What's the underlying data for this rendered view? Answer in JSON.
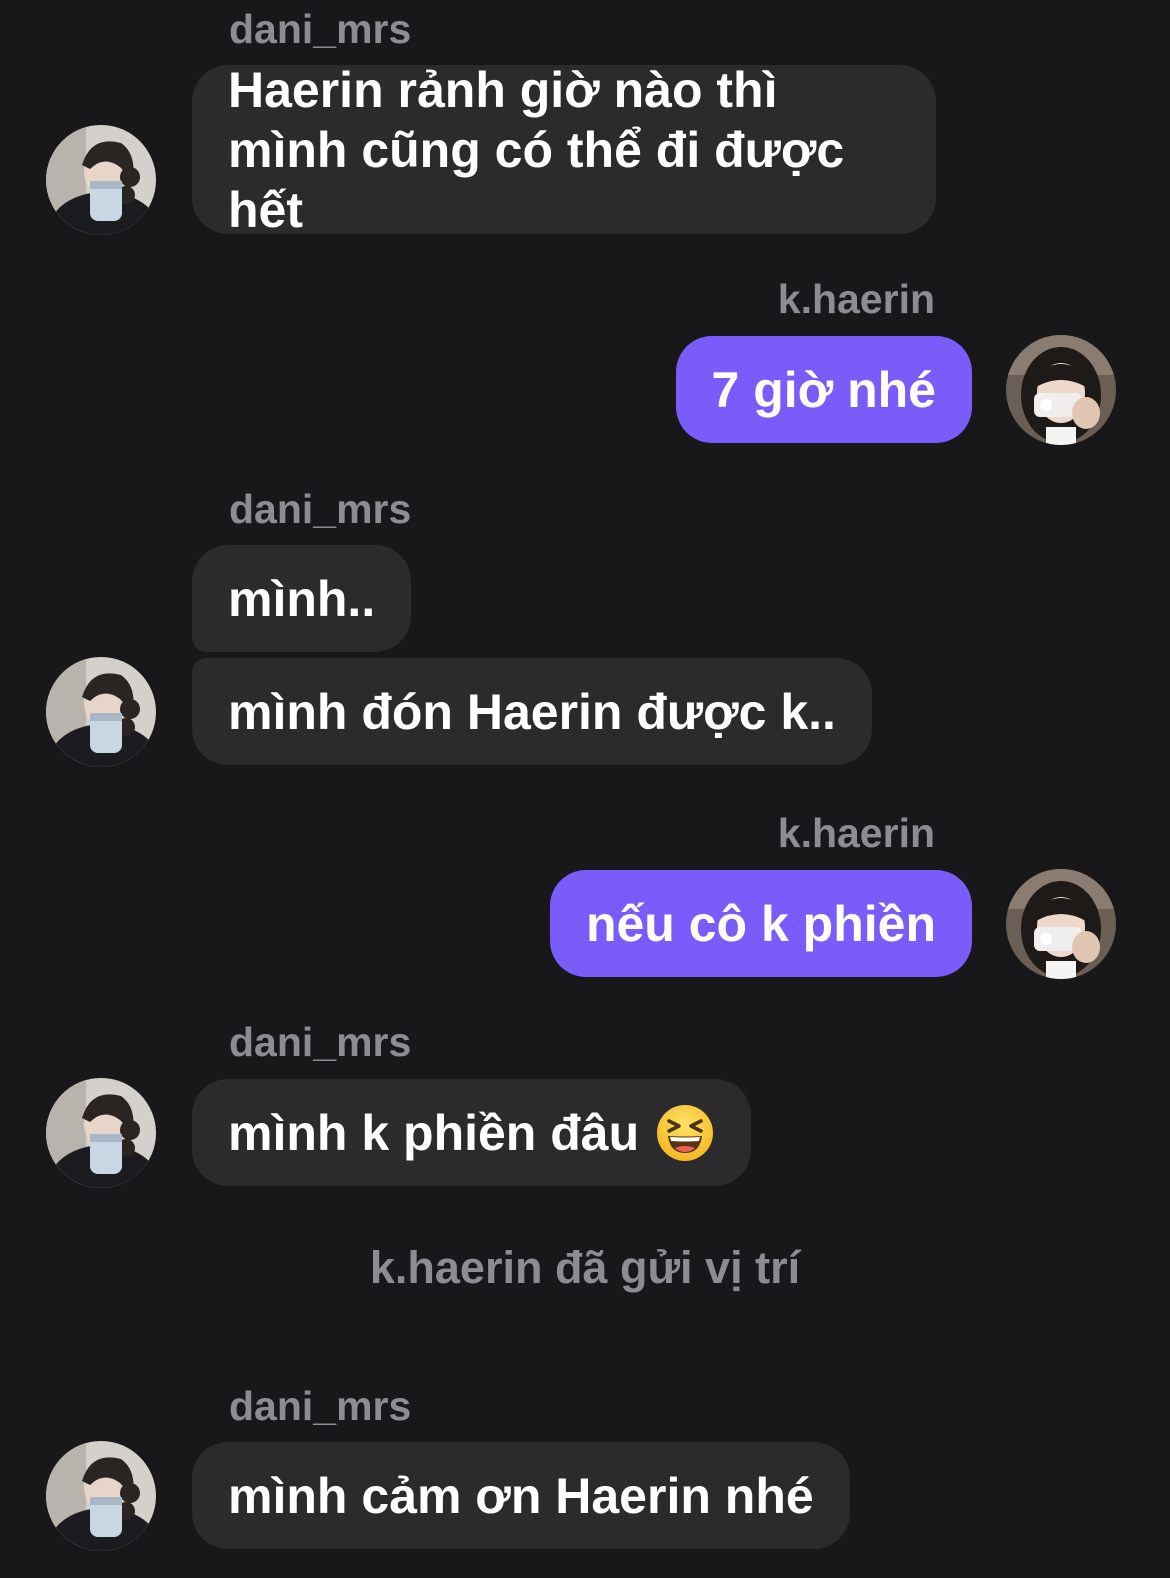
{
  "users": {
    "other": "dani_mrs",
    "me": "k.haerin"
  },
  "messages": [
    {
      "sender": "dani_mrs",
      "text": "Haerin rảnh giờ nào thì mình cũng có thể đi được hết"
    },
    {
      "sender": "k.haerin",
      "text": "7 giờ nhé"
    },
    {
      "sender": "dani_mrs",
      "text": "mình.."
    },
    {
      "sender": "dani_mrs",
      "text": "mình đón Haerin được k.."
    },
    {
      "sender": "k.haerin",
      "text": "nếu cô k phiền"
    },
    {
      "sender": "dani_mrs",
      "text": "mình k phiền đâu",
      "emoji": "grinning-squinting-face"
    },
    {
      "system": true,
      "text": "k.haerin đã gửi vị trí"
    },
    {
      "sender": "dani_mrs",
      "text": "mình cảm ơn Haerin nhé"
    }
  ],
  "colors": {
    "background": "#18181a",
    "incoming_bubble": "#2b2b2e",
    "outgoing_bubble": "#7a5cfa",
    "name_text": "#8c8c93",
    "message_text": "#ffffff"
  }
}
